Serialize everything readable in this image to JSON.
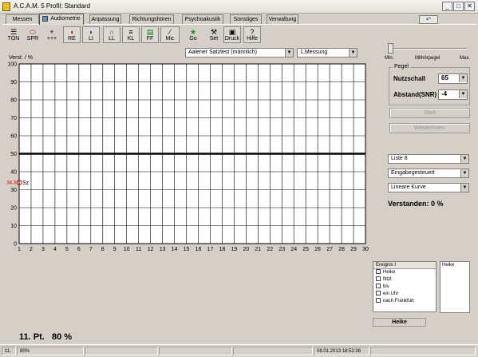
{
  "window": {
    "title": "A.C.A.M. 5 Profil: Standard",
    "minimize_label": "_",
    "maximize_label": "□",
    "close_label": "✕"
  },
  "tabs": [
    {
      "label": "Messen",
      "active": false
    },
    {
      "label": "Audiometrie",
      "active": true
    },
    {
      "label": "Anpassung",
      "active": false
    },
    {
      "label": "Richtungshören",
      "active": false
    },
    {
      "label": "Psychoakustik",
      "active": false
    },
    {
      "label": "Sonstiges",
      "active": false
    },
    {
      "label": "Verwaltung",
      "active": false
    }
  ],
  "help_icon": "undo-arrow-icon",
  "toolbar": [
    {
      "label": "TON",
      "icon": "sliders-icon"
    },
    {
      "label": "SPR",
      "icon": "lips-icon"
    },
    {
      "label": "+++",
      "icon": "plus-icon"
    },
    {
      "label": "RE",
      "icon": "right-ear-icon"
    },
    {
      "label": "LI",
      "icon": "left-ear-icon"
    },
    {
      "label": "LL",
      "icon": "headphones-icon"
    },
    {
      "label": "KL",
      "icon": "bone-icon"
    },
    {
      "label": "FF",
      "icon": "speaker-icon"
    },
    {
      "label": "Mic",
      "icon": "microphone-icon"
    },
    {
      "label": "Go",
      "icon": "running-man-icon"
    },
    {
      "label": "Set",
      "icon": "tools-icon"
    },
    {
      "label": "Druck",
      "icon": "printer-icon"
    },
    {
      "label": "Hilfe",
      "icon": "question-icon"
    }
  ],
  "test_select": "Aalener Satztest (männlich)",
  "measurement_select": "1.Messung",
  "chart_data": {
    "type": "line",
    "ylabel": "Verst. / %",
    "ylim": [
      0,
      100
    ],
    "yticks": [
      0,
      10,
      20,
      30,
      40,
      50,
      60,
      70,
      80,
      90,
      100
    ],
    "xlim": [
      1,
      30
    ],
    "xticks": [
      1,
      2,
      3,
      4,
      5,
      6,
      7,
      8,
      9,
      10,
      11,
      12,
      13,
      14,
      15,
      16,
      17,
      18,
      19,
      20,
      21,
      22,
      23,
      24,
      25,
      26,
      27,
      28,
      29,
      30
    ],
    "reference_line_y": 50,
    "marker": {
      "x": 1,
      "y": 34,
      "left_label": "34.3",
      "right_label": "Sz",
      "color": "#d00000"
    },
    "grid": true
  },
  "slider": {
    "min_label": "Min.",
    "mid_label": "Mithörpegel",
    "max_label": "Max.",
    "value": 0
  },
  "pegel": {
    "group_label": "Pegel",
    "noise_label": "Nutzschall",
    "noise_value": "65",
    "snr_label": "Abstand(SNR)",
    "snr_value": "-4"
  },
  "buttons": {
    "start": "Start",
    "repeat": "Wiederholen"
  },
  "list_select": "Liste 8",
  "mode_select": "Eingabegesteuert",
  "curve_select": "Lineare Kurve",
  "understood": "Verstanden: 0 %",
  "events": {
    "header": "Ereignis I",
    "items": [
      "Heike",
      "flitzt",
      "bis",
      "ein Uhr",
      "nach Frankfurt"
    ]
  },
  "heike_box": "Heike",
  "heike_label": "Heike",
  "score": "11. Pt.   80 %",
  "status": {
    "cell1": "11.",
    "cell2": "80%",
    "datetime": "08.01.2013 18:52:36"
  }
}
